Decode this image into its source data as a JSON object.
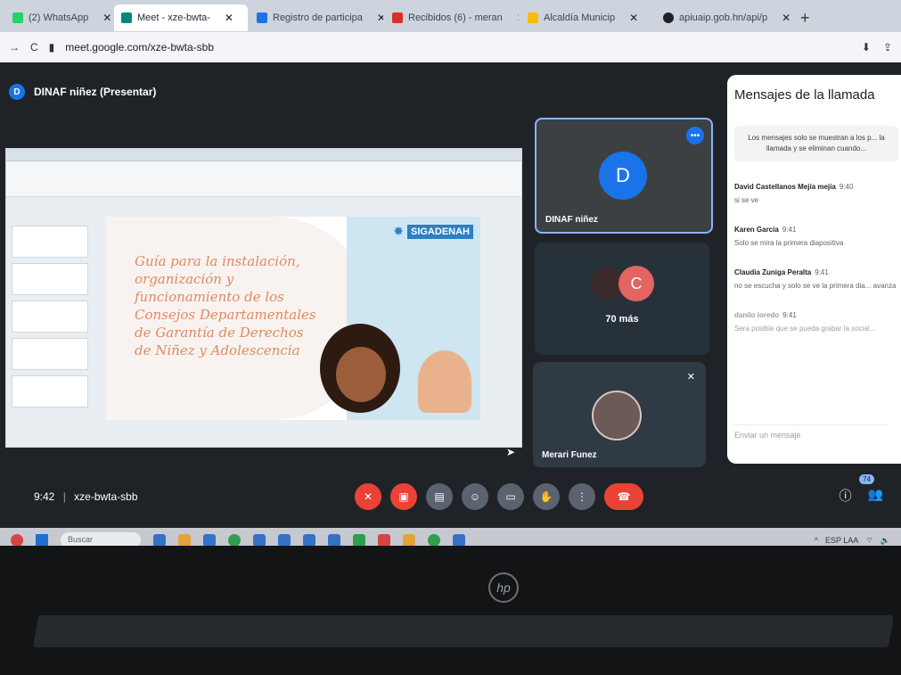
{
  "browser": {
    "tabs": [
      {
        "label": "(2) WhatsApp",
        "color": "#25d366"
      },
      {
        "label": "Meet - xze-bwta-",
        "color": "#00897b",
        "active": true
      },
      {
        "label": "Registro de participa",
        "color": "#1a73e8"
      },
      {
        "label": "Recibidos (6) - meran",
        "color": "#d93025"
      },
      {
        "label": "Alcaldía Municip",
        "color": "#fbbc04"
      },
      {
        "label": "apiuaip.gob.hn/api/p",
        "color": "#202124"
      }
    ],
    "url": "meet.google.com/xze-bwta-sbb"
  },
  "meet": {
    "presenter_initial": "D",
    "presenter_label": "DINAF niñez (Presentar)",
    "slide": {
      "title_lines": [
        "Guía para la instalación,",
        "organización y",
        "funcionamiento de los",
        "Consejos Departamentales",
        "de Garantía de Derechos",
        "de Niñez y Adolescencia"
      ],
      "logo": "SIGADENAH"
    },
    "tiles": {
      "main": {
        "initial": "D",
        "name": "DINAF niñez"
      },
      "group": {
        "initial": "C",
        "more": "70 más"
      },
      "self": {
        "name": "Merari Funez"
      }
    },
    "meeting_time": "9:42",
    "meeting_code": "xze-bwta-sbb",
    "participants_badge": "74"
  },
  "chat": {
    "title": "Mensajes de la llamada",
    "notice": "Los mensajes solo se muestran a los p... la llamada y se eliminan cuando...",
    "messages": [
      {
        "author": "David Castellanos Mejía mejía",
        "time": "9:40",
        "text": "si se ve"
      },
      {
        "author": "Karen García",
        "time": "9:41",
        "text": "Solo se mira la primera diapositiva"
      },
      {
        "author": "Claudia Zuniga Peralta",
        "time": "9:41",
        "text": "no se escucha y solo se ve la primera dia... avanza"
      },
      {
        "author": "danilo loredo",
        "time": "9:41",
        "text": "Sera posible que se pueda grabar la social..."
      }
    ],
    "input_placeholder": "Enviar un mensaje"
  },
  "taskbar": {
    "search_placeholder": "Buscar",
    "tray_lang": "ESP LAA"
  },
  "laptop": {
    "brand": "hp"
  }
}
